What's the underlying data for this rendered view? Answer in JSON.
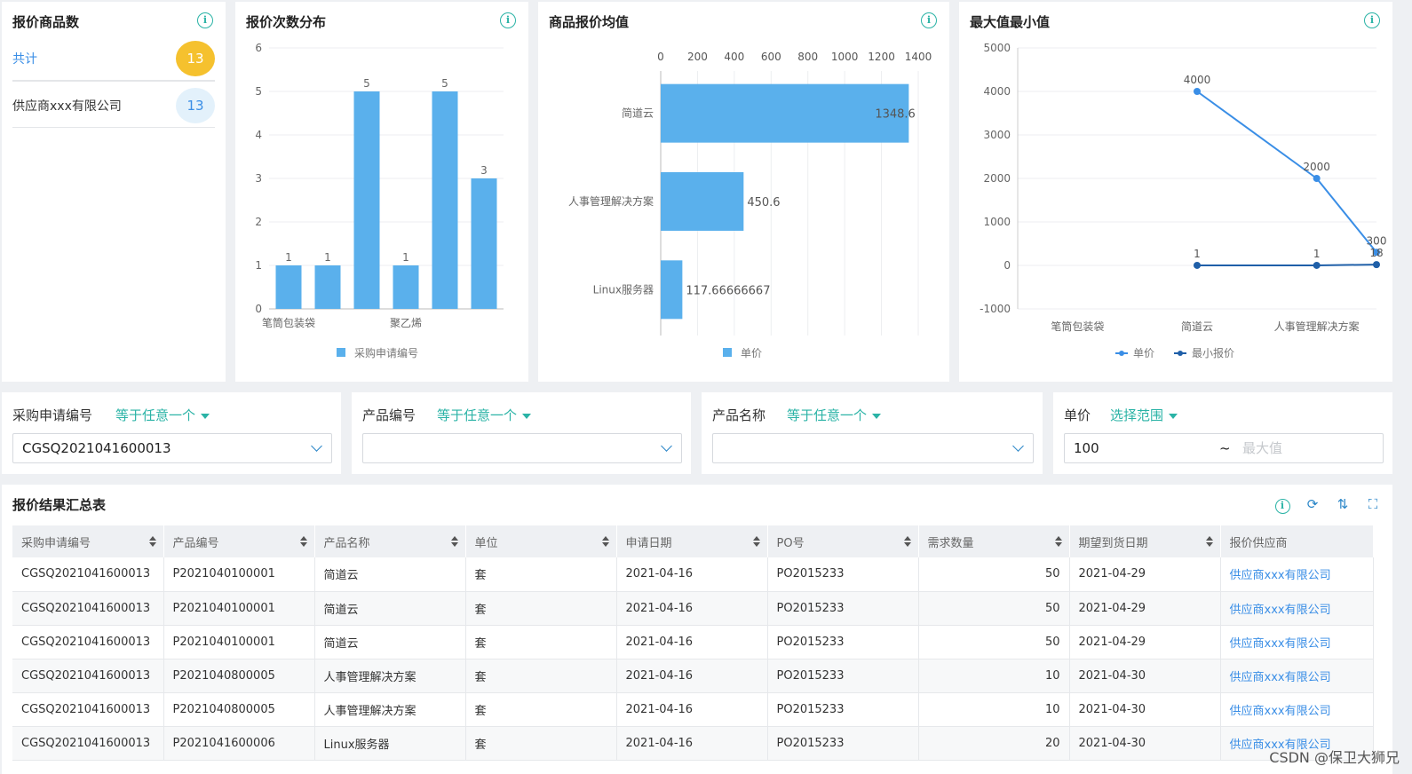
{
  "cards": {
    "count": {
      "title": "报价商品数",
      "rows": [
        {
          "label": "共计",
          "value": "13"
        },
        {
          "label": "供应商xxx有限公司",
          "value": "13"
        }
      ]
    },
    "freq": {
      "title": "报价次数分布"
    },
    "avg": {
      "title": "商品报价均值"
    },
    "maxmin": {
      "title": "最大值最小值"
    }
  },
  "info_icon": "i",
  "chart_data": [
    {
      "type": "bar",
      "title": "报价次数分布",
      "categories": [
        "笔筒包装袋",
        "",
        "",
        "聚乙烯",
        "",
        ""
      ],
      "series": [
        {
          "name": "采购申请编号",
          "values": [
            1,
            1,
            5,
            1,
            5,
            3
          ]
        }
      ],
      "ylim": [
        0,
        6
      ],
      "yticks": [
        "0",
        "1",
        "2",
        "3",
        "4",
        "5",
        "6"
      ],
      "legend": "bottom",
      "color": "#5ab0ec"
    },
    {
      "type": "bar",
      "orientation": "horizontal",
      "title": "商品报价均值",
      "categories": [
        "简道云",
        "人事管理解决方案",
        "Linux服务器"
      ],
      "series": [
        {
          "name": "单价",
          "values": [
            1348.6,
            450.6,
            117.66666667
          ],
          "labels": [
            "1348.6",
            "450.6",
            "117.66666667"
          ]
        }
      ],
      "xlim": [
        0,
        1400
      ],
      "xticks": [
        "0",
        "200",
        "400",
        "600",
        "800",
        "1000",
        "1200",
        "1400"
      ],
      "legend": "bottom",
      "color": "#5ab0ec"
    },
    {
      "type": "line",
      "title": "最大值最小值",
      "categories": [
        "笔筒包装袋",
        "简道云",
        "人事管理解决方案"
      ],
      "extra_point_index": 2.5,
      "series": [
        {
          "name": "单价",
          "points": [
            {
              "x": 1,
              "y": 4000,
              "label": "4000"
            },
            {
              "x": 2,
              "y": 2000,
              "label": "2000"
            },
            {
              "x": 2.5,
              "y": 300,
              "label": "300"
            }
          ],
          "color": "#3a8ee6"
        },
        {
          "name": "最小报价",
          "points": [
            {
              "x": 1,
              "y": 1,
              "label": "1"
            },
            {
              "x": 2,
              "y": 1,
              "label": "1"
            },
            {
              "x": 2.5,
              "y": 18,
              "label": "18"
            }
          ],
          "color": "#1f5fa8"
        }
      ],
      "ylim": [
        -1000,
        5000
      ],
      "yticks": [
        "-1000",
        "0",
        "1000",
        "2000",
        "3000",
        "4000",
        "5000"
      ],
      "legend": "bottom"
    }
  ],
  "filters": [
    {
      "label": "采购申请编号",
      "op": "等于任意一个",
      "value": "CGSQ2021041600013"
    },
    {
      "label": "产品编号",
      "op": "等于任意一个",
      "value": ""
    },
    {
      "label": "产品名称",
      "op": "等于任意一个",
      "value": ""
    },
    {
      "label": "单价",
      "op": "选择范围",
      "min": "100",
      "sep": "~",
      "max_placeholder": "最大值"
    }
  ],
  "table": {
    "title": "报价结果汇总表",
    "columns": [
      "采购申请编号",
      "产品编号",
      "产品名称",
      "单位",
      "申请日期",
      "PO号",
      "需求数量",
      "期望到货日期",
      "报价供应商"
    ],
    "rows": [
      [
        "CGSQ2021041600013",
        "P2021040100001",
        "简道云",
        "套",
        "2021-04-16",
        "PO2015233",
        "50",
        "2021-04-29",
        "供应商xxx有限公司"
      ],
      [
        "CGSQ2021041600013",
        "P2021040100001",
        "简道云",
        "套",
        "2021-04-16",
        "PO2015233",
        "50",
        "2021-04-29",
        "供应商xxx有限公司"
      ],
      [
        "CGSQ2021041600013",
        "P2021040100001",
        "简道云",
        "套",
        "2021-04-16",
        "PO2015233",
        "50",
        "2021-04-29",
        "供应商xxx有限公司"
      ],
      [
        "CGSQ2021041600013",
        "P2021040800005",
        "人事管理解决方案",
        "套",
        "2021-04-16",
        "PO2015233",
        "10",
        "2021-04-30",
        "供应商xxx有限公司"
      ],
      [
        "CGSQ2021041600013",
        "P2021040800005",
        "人事管理解决方案",
        "套",
        "2021-04-16",
        "PO2015233",
        "10",
        "2021-04-30",
        "供应商xxx有限公司"
      ],
      [
        "CGSQ2021041600013",
        "P2021041600006",
        "Linux服务器",
        "套",
        "2021-04-16",
        "PO2015233",
        "20",
        "2021-04-30",
        "供应商xxx有限公司"
      ]
    ],
    "tool_icons": [
      "info-icon",
      "refresh-icon",
      "sort-icon",
      "fullscreen-icon"
    ]
  },
  "watermark": "CSDN @保卫大狮兄",
  "colors": {
    "accent": "#2ab3a6",
    "bar": "#5ab0ec",
    "badge_primary": "#f5c12e",
    "badge_secondary": "#e3f1fb",
    "link": "#3a8ee6"
  }
}
